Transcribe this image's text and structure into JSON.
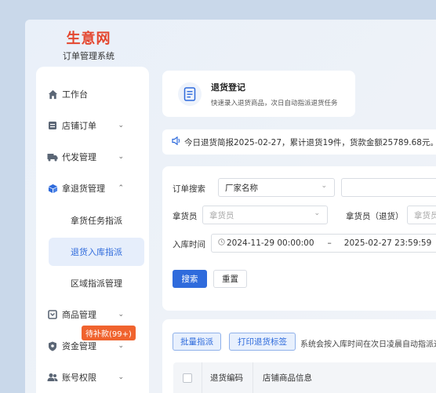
{
  "brand": {
    "logo": "生意网",
    "subtitle": "订单管理系统"
  },
  "sidebar": {
    "items": [
      {
        "label": "工作台",
        "icon": "home-icon",
        "chevron": ""
      },
      {
        "label": "店铺订单",
        "icon": "store-icon",
        "chevron": "⌄"
      },
      {
        "label": "代发管理",
        "icon": "truck-icon",
        "chevron": "⌄"
      },
      {
        "label": "拿退货管理",
        "icon": "box-icon",
        "chevron": "⌃"
      },
      {
        "label": "商品管理",
        "icon": "product-icon",
        "chevron": "⌄"
      },
      {
        "label": "资金管理",
        "icon": "shield-icon",
        "chevron": "⌄"
      },
      {
        "label": "账号权限",
        "icon": "users-icon",
        "chevron": "⌄"
      }
    ],
    "sub_items": [
      {
        "label": "拿货任务指派"
      },
      {
        "label": "退货入库指派"
      },
      {
        "label": "区域指派管理"
      }
    ],
    "badge": "待补款(99+)"
  },
  "hero": {
    "title": "退货登记",
    "subtitle": "快速录入退货商品，次日自动指派退货任务"
  },
  "notice": {
    "text": "今日退货简报2025-02-27，累计退货19件，货款金额25789.68元。"
  },
  "search": {
    "order_label": "订单搜索",
    "order_select": "厂家名称",
    "picker_label": "拿货员",
    "picker_placeholder": "拿货员",
    "return_picker_label": "拿货员（退货）",
    "return_picker_placeholder": "拿货员",
    "time_label": "入库时间",
    "time_start": "2024-11-29 00:00:00",
    "time_sep": "–",
    "time_end": "2025-02-27 23:59:59",
    "search_btn": "搜索",
    "reset_btn": "重置"
  },
  "table": {
    "batch_btn": "批量指派",
    "print_btn": "打印退货标签",
    "hint": "系统会按入库时间在次日凌晨自动指派退",
    "columns": [
      "退货编码",
      "店铺商品信息"
    ]
  },
  "colors": {
    "accent": "#2f6bdc",
    "brand": "#e4462e",
    "badge": "#f0632e"
  }
}
